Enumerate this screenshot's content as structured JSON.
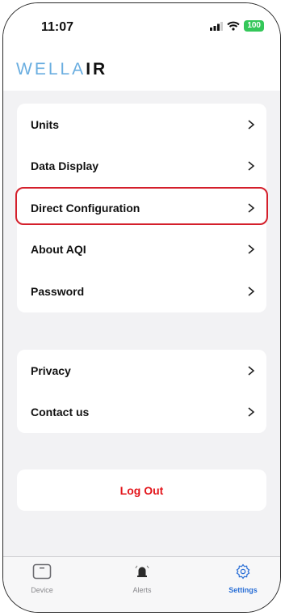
{
  "status_bar": {
    "time": "11:07",
    "battery": "100"
  },
  "header": {
    "logo_well": "WELLA",
    "logo_air": "IR"
  },
  "settings_group_1": [
    {
      "label": "Units"
    },
    {
      "label": "Data Display"
    },
    {
      "label": "Direct Configuration"
    },
    {
      "label": "About AQI"
    },
    {
      "label": "Password"
    }
  ],
  "settings_group_2": [
    {
      "label": "Privacy"
    },
    {
      "label": "Contact us"
    }
  ],
  "logout": {
    "label": "Log Out"
  },
  "tabbar": [
    {
      "label": "Device",
      "icon": "device-icon"
    },
    {
      "label": "Alerts",
      "icon": "bell-icon"
    },
    {
      "label": "Settings",
      "icon": "gear-icon",
      "active": true
    }
  ],
  "colors": {
    "accent": "#2a6fd6",
    "logout": "#e3161c",
    "highlight": "#d41f2b",
    "logo_blue": "#6aaee0"
  }
}
